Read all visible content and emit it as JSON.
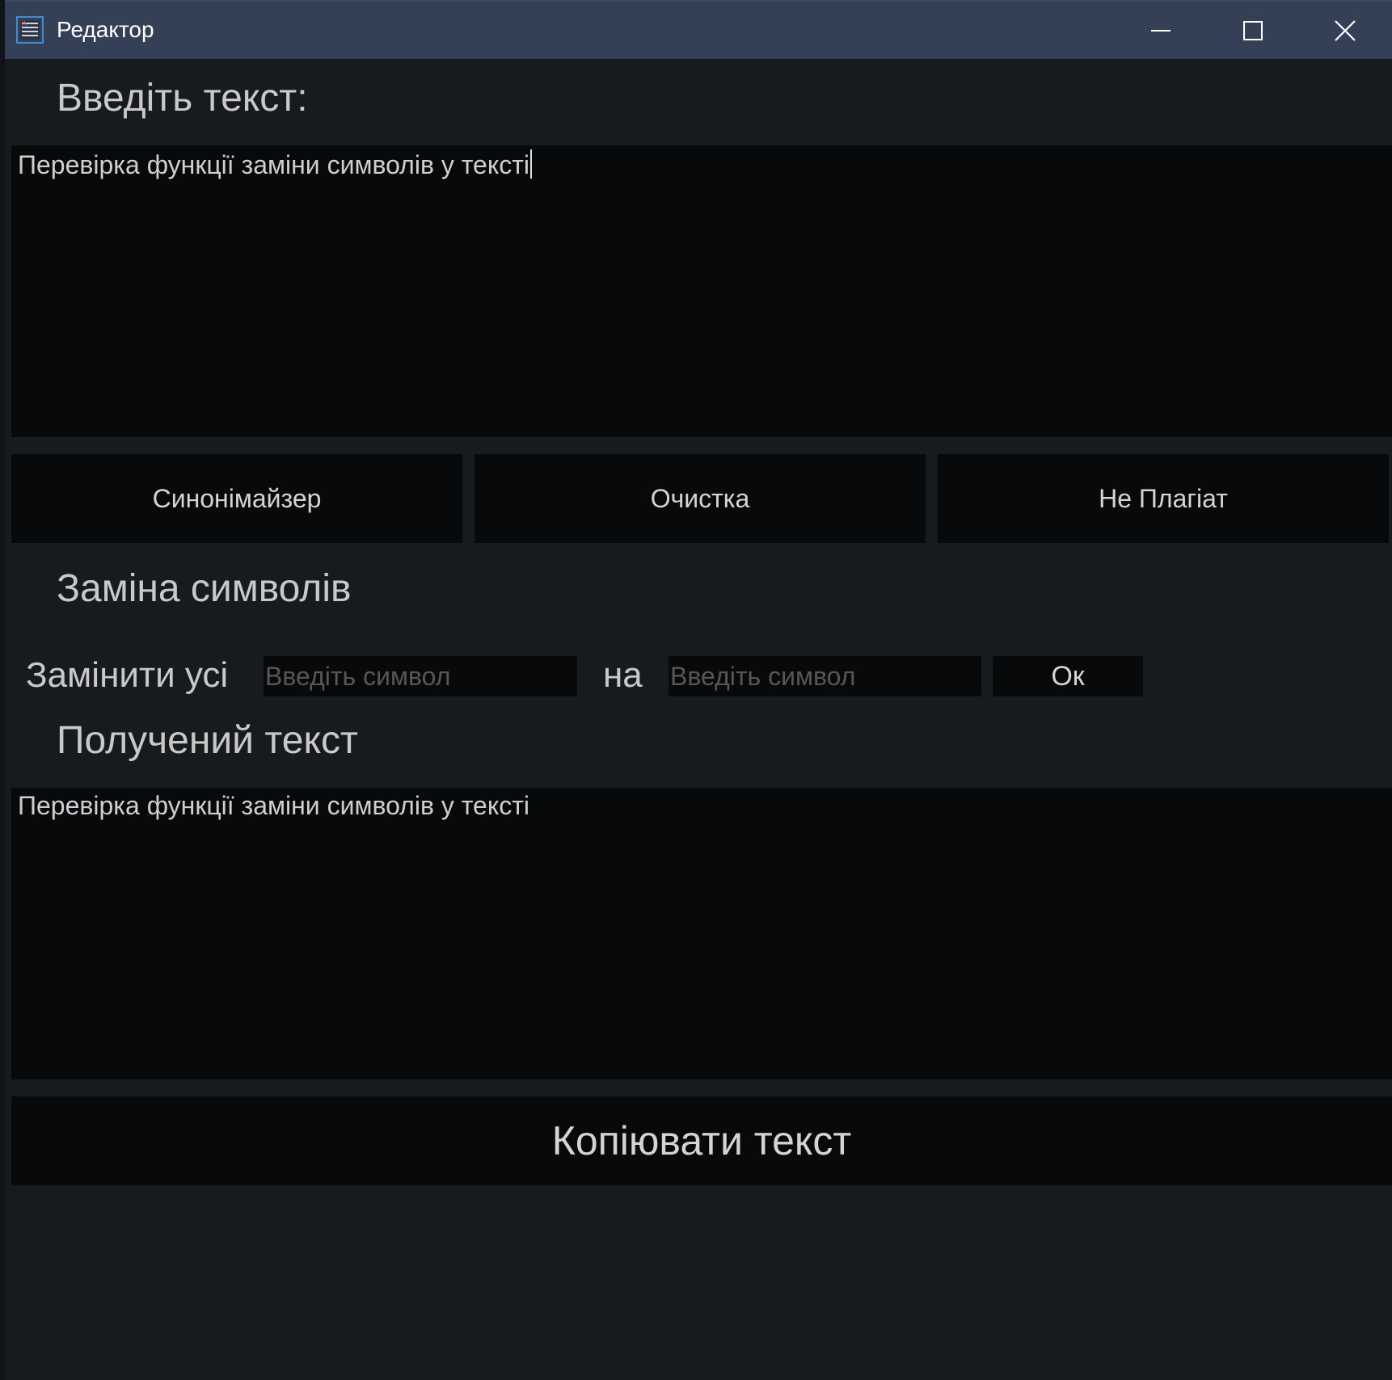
{
  "window": {
    "title": "Редактор",
    "icon": "text-editor-icon",
    "controls": {
      "minimize_icon": "minimize-icon",
      "maximize_icon": "maximize-icon",
      "close_icon": "close-icon"
    }
  },
  "colors": {
    "titlebar": "#344055",
    "background": "#181b1e",
    "field_background": "#07090b",
    "text": "#c9c9c9",
    "placeholder": "#575757"
  },
  "input_section": {
    "heading": "Введіть текст:",
    "text": "Перевірка функції заміни символів у тексті"
  },
  "actions": {
    "synonymizer": "Синонімайзер",
    "clear": "Очистка",
    "not_plagiarism": "Не Плагіат"
  },
  "replace_section": {
    "heading": "Заміна символів",
    "replace_all_label": "Замінити усі",
    "from_placeholder": "Введіть символ",
    "from_value": "",
    "to_label": "на",
    "to_placeholder": "Введіть символ",
    "to_value": "",
    "ok_label": "Ок"
  },
  "output_section": {
    "heading": "Получений текст",
    "text": "Перевірка функції заміни символів у тексті"
  },
  "copy_button": {
    "label": "Копіювати текст"
  }
}
